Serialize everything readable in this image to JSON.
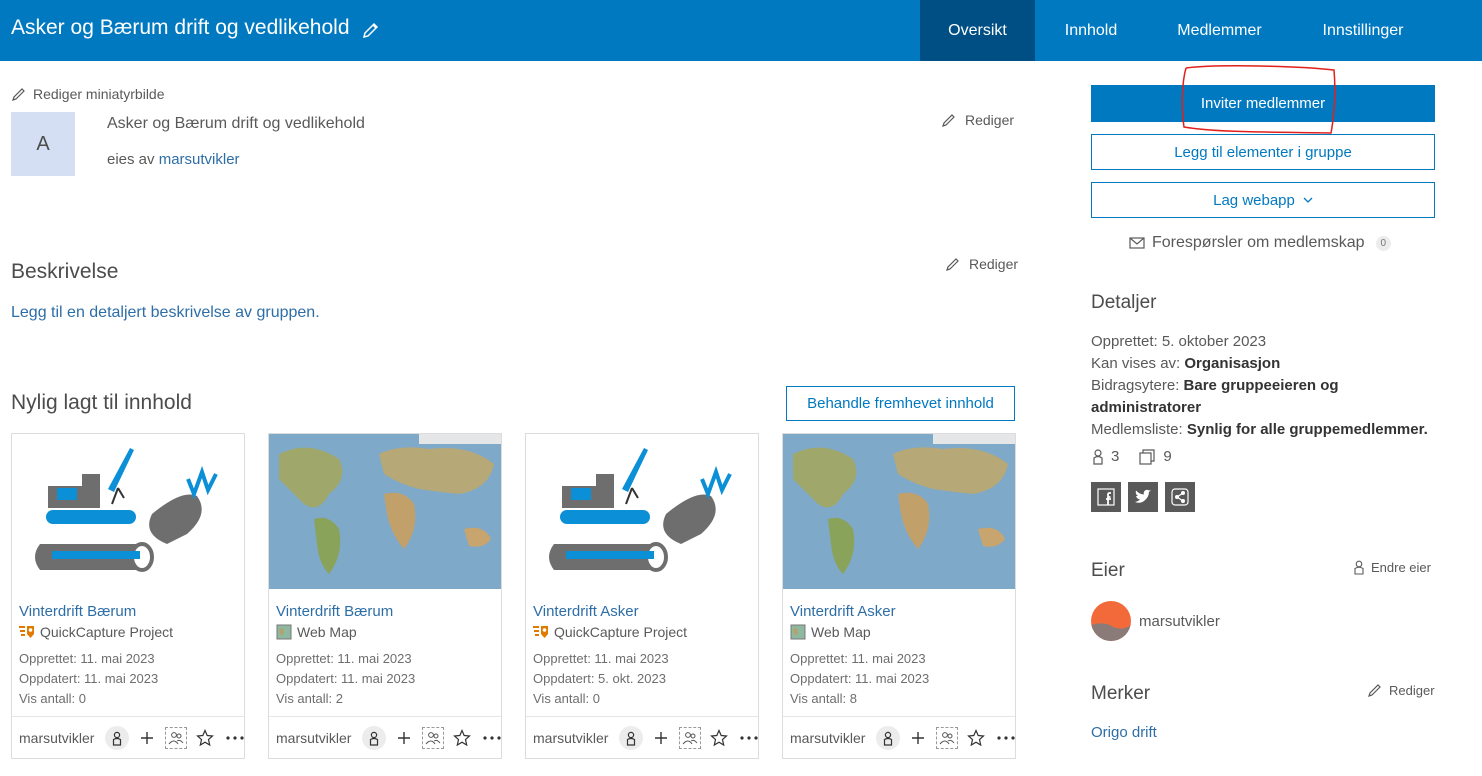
{
  "header": {
    "title": "Asker og Bærum drift og vedlikehold",
    "tabs": [
      {
        "label": "Oversikt",
        "active": true
      },
      {
        "label": "Innhold",
        "active": false
      },
      {
        "label": "Medlemmer",
        "active": false
      },
      {
        "label": "Innstillinger",
        "active": false
      }
    ]
  },
  "colors": {
    "brand": "#0079c1",
    "active_tab": "#004f84",
    "link": "#2e6ea6",
    "thumb_bg": "#d4dff3"
  },
  "group": {
    "edit_thumbnail_label": "Rediger miniatyrbilde",
    "thumbnail_letter": "A",
    "name": "Asker og Bærum drift og vedlikehold",
    "owned_by_prefix": "eies av",
    "owner": "marsutvikler",
    "edit_label": "Rediger"
  },
  "description": {
    "title": "Beskrivelse",
    "edit_label": "Rediger",
    "add_link": "Legg til en detaljert beskrivelse av gruppen."
  },
  "recent": {
    "title": "Nylig lagt til innhold",
    "manage_button": "Behandle fremhevet innhold",
    "cards": [
      {
        "title": "Vinterdrift Bærum",
        "type": "QuickCapture Project",
        "type_icon": "quickcapture-icon",
        "image": "excavator",
        "created": "Opprettet: 11. mai 2023",
        "updated": "Oppdatert: 11. mai 2023",
        "views": "Vis antall: 0",
        "owner": "marsutvikler"
      },
      {
        "title": "Vinterdrift Bærum",
        "type": "Web Map",
        "type_icon": "webmap-icon",
        "image": "map",
        "created": "Opprettet: 11. mai 2023",
        "updated": "Oppdatert: 11. mai 2023",
        "views": "Vis antall: 2",
        "owner": "marsutvikler"
      },
      {
        "title": "Vinterdrift Asker",
        "type": "QuickCapture Project",
        "type_icon": "quickcapture-icon",
        "image": "excavator",
        "created": "Opprettet: 11. mai 2023",
        "updated": "Oppdatert: 5. okt. 2023",
        "views": "Vis antall: 0",
        "owner": "marsutvikler"
      },
      {
        "title": "Vinterdrift Asker",
        "type": "Web Map",
        "type_icon": "webmap-icon",
        "image": "map",
        "created": "Opprettet: 11. mai 2023",
        "updated": "Oppdatert: 11. mai 2023",
        "views": "Vis antall: 8",
        "owner": "marsutvikler"
      }
    ]
  },
  "sidebar": {
    "invite_button": "Inviter medlemmer",
    "add_items_button": "Legg til elementer i gruppe",
    "webapp_button": "Lag webapp",
    "requests_label": "Forespørsler om medlemskap",
    "requests_count": "0",
    "details_title": "Detaljer",
    "created": {
      "label": "Opprettet:",
      "value": "5. oktober 2023"
    },
    "visible_to": {
      "label": "Kan vises av:",
      "value": "Organisasjon"
    },
    "contributors": {
      "label": "Bidragsytere:",
      "value": "Bare gruppeeieren og administratorer"
    },
    "member_list": {
      "label": "Medlemsliste:",
      "value": "Synlig for alle gruppemedlemmer."
    },
    "member_count": "3",
    "item_count": "9",
    "share_icons": [
      "facebook-icon",
      "twitter-icon",
      "share-icon"
    ],
    "owner_title": "Eier",
    "change_owner": "Endre eier",
    "owner_name": "marsutvikler",
    "tags_title": "Merker",
    "tags_edit": "Rediger",
    "tags": [
      "Origo drift"
    ]
  }
}
